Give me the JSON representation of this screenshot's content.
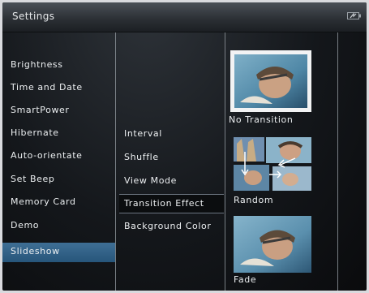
{
  "header": {
    "title": "Settings"
  },
  "menu": {
    "items": [
      {
        "label": "Brightness"
      },
      {
        "label": "Time and Date"
      },
      {
        "label": "SmartPower"
      },
      {
        "label": "Hibernate"
      },
      {
        "label": "Auto-orientate"
      },
      {
        "label": "Set Beep"
      },
      {
        "label": "Memory Card"
      },
      {
        "label": "Demo"
      },
      {
        "label": "Slideshow",
        "selected": true
      }
    ]
  },
  "submenu": {
    "items": [
      {
        "label": "Interval"
      },
      {
        "label": "Shuffle"
      },
      {
        "label": "View Mode"
      },
      {
        "label": "Transition Effect",
        "selected": true
      },
      {
        "label": "Background Color"
      }
    ]
  },
  "options": {
    "items": [
      {
        "label": "No Transition",
        "selected": true
      },
      {
        "label": "Random"
      },
      {
        "label": "Fade"
      }
    ]
  },
  "icons": {
    "battery": "battery-icon"
  },
  "colors": {
    "selection": "#2f6189",
    "background": "#14171b"
  }
}
